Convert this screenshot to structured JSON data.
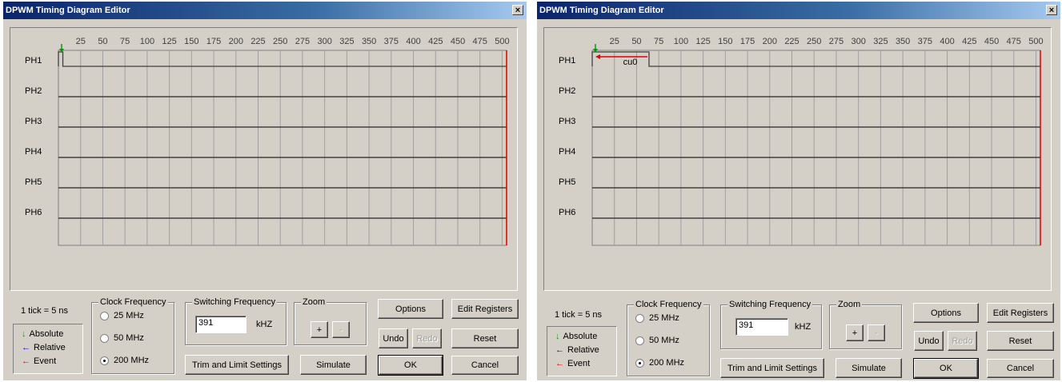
{
  "windows": [
    {
      "title": "DPWM Timing Diagram Editor",
      "close_glyph": "×",
      "ticks": [
        "25",
        "50",
        "75",
        "100",
        "125",
        "150",
        "175",
        "200",
        "225",
        "250",
        "275",
        "300",
        "325",
        "350",
        "375",
        "400",
        "425",
        "450",
        "475",
        "500"
      ],
      "phases": [
        "PH1",
        "PH2",
        "PH3",
        "PH4",
        "PH5",
        "PH6"
      ],
      "ph1_pulse_end": 5,
      "event_label": "",
      "tick_info": "1 tick = 5 ns",
      "legend": {
        "absolute": "Absolute",
        "relative": "Relative",
        "event": "Event"
      },
      "clock": {
        "title": "Clock Frequency",
        "options": [
          "25 MHz",
          "50 MHz",
          "200 MHz"
        ],
        "selected": 2
      },
      "switching": {
        "title": "Switching Frequency",
        "value": "391",
        "unit": "kHZ"
      },
      "zoom": {
        "title": "Zoom",
        "plus": "+",
        "minus": "-"
      },
      "buttons": {
        "options": "Options",
        "edit_registers": "Edit Registers",
        "undo": "Undo",
        "redo": "Redo",
        "reset": "Reset",
        "trim": "Trim and Limit Settings",
        "simulate": "Simulate",
        "ok": "OK",
        "cancel": "Cancel"
      },
      "colors": {
        "grid": "#a0a0a0",
        "trace": "#404040",
        "end_marker": "#e00000",
        "absolute": "#00a000",
        "relative": "#0000ff",
        "event": "#e00000"
      }
    },
    {
      "title": "DPWM Timing Diagram Editor",
      "close_glyph": "×",
      "ticks": [
        "25",
        "50",
        "75",
        "100",
        "125",
        "150",
        "175",
        "200",
        "225",
        "250",
        "275",
        "300",
        "325",
        "350",
        "375",
        "400",
        "425",
        "450",
        "475",
        "500"
      ],
      "phases": [
        "PH1",
        "PH2",
        "PH3",
        "PH4",
        "PH5",
        "PH6"
      ],
      "ph1_pulse_end": 64,
      "event_label": "cu0",
      "tick_info": "1 tick = 5 ns",
      "legend": {
        "absolute": "Absolute",
        "relative": "Relative",
        "event": "Event"
      },
      "clock": {
        "title": "Clock Frequency",
        "options": [
          "25 MHz",
          "50 MHz",
          "200 MHz"
        ],
        "selected": 2
      },
      "switching": {
        "title": "Switching Frequency",
        "value": "391",
        "unit": "kHZ"
      },
      "zoom": {
        "title": "Zoom",
        "plus": "+",
        "minus": "-"
      },
      "buttons": {
        "options": "Options",
        "edit_registers": "Edit Registers",
        "undo": "Undo",
        "redo": "Redo",
        "reset": "Reset",
        "trim": "Trim and Limit Settings",
        "simulate": "Simulate",
        "ok": "OK",
        "cancel": "Cancel"
      },
      "colors": {
        "grid": "#a0a0a0",
        "trace": "#404040",
        "end_marker": "#e00000",
        "absolute": "#00a000",
        "relative": "#0000ff",
        "event": "#e00000"
      }
    }
  ]
}
